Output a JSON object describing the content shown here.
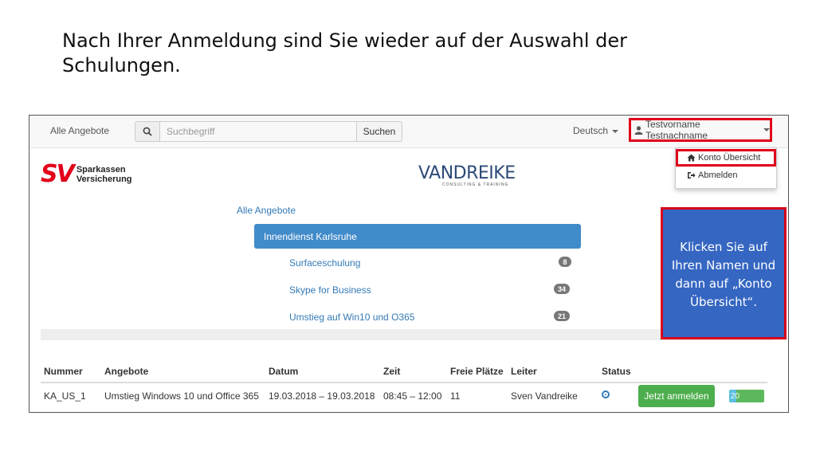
{
  "slide": {
    "title": "Nach Ihrer Anmeldung sind Sie wieder auf der Auswahl der Schulungen."
  },
  "navbar": {
    "brand": "Alle Angebote",
    "search_placeholder": "Suchbegriff",
    "search_button": "Suchen",
    "language": "Deutsch",
    "user_name": "Testvorname Testnachname"
  },
  "user_dropdown": {
    "items": [
      {
        "label": "Konto Übersicht",
        "icon": "home-icon"
      },
      {
        "label": "Abmelden",
        "icon": "sign-out-icon"
      }
    ]
  },
  "logos": {
    "sv_mark": "SV",
    "sv_name_line1": "Sparkassen",
    "sv_name_line2": "Versicherung",
    "vandreike": "VANDREIKE",
    "vandreike_sub": "CONSULTING & TRAINING"
  },
  "catalog": {
    "breadcrumb": "Alle Angebote",
    "active_category": "Innendienst Karlsruhe",
    "courses": [
      {
        "label": "Surfaceschulung",
        "count": "8"
      },
      {
        "label": "Skype for Business",
        "count": "34"
      },
      {
        "label": "Umstieg auf Win10 und O365",
        "count": "21"
      }
    ]
  },
  "table": {
    "headers": [
      "Nummer",
      "Angebote",
      "Datum",
      "Zeit",
      "Freie Plätze",
      "Leiter",
      "Status"
    ],
    "rows": [
      {
        "nummer": "KA_US_1",
        "angebot": "Umstieg Windows 10 und Office 365",
        "datum": "19.03.2018 – 19.03.2018",
        "zeit": "08:45 – 12:00",
        "freie_plaetze": "11",
        "leiter": "Sven Vandreike",
        "action_label": "Jetzt anmelden",
        "progress_label": "20",
        "progress_fraction": 0.2
      }
    ]
  },
  "callout": {
    "text": "Klicken Sie auf Ihren Namen und dann auf „Konto Übersicht“."
  },
  "colors": {
    "highlight_red": "#e0001a",
    "primary_blue": "#428bca",
    "success_green": "#4cae4c",
    "callout_blue": "#3566c2"
  }
}
